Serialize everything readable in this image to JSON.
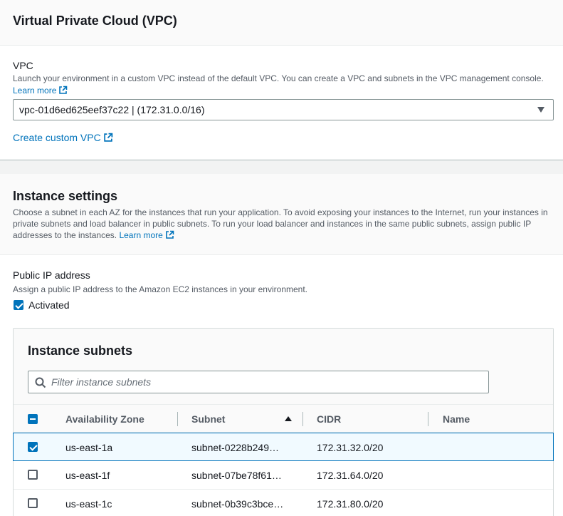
{
  "vpc_section": {
    "title": "Virtual Private Cloud (VPC)",
    "vpc_label": "VPC",
    "vpc_description": "Launch your environment in a custom VPC instead of the default VPC. You can create a VPC and subnets in the VPC management console.",
    "learn_more": "Learn more",
    "vpc_select_value": "vpc-01d6ed625eef37c22 | (172.31.0.0/16)",
    "create_custom_vpc": "Create custom VPC"
  },
  "instance_settings": {
    "title": "Instance settings",
    "description": "Choose a subnet in each AZ for the instances that run your application. To avoid exposing your instances to the Internet, run your instances in private subnets and load balancer in public subnets. To run your load balancer and instances in the same public subnets, assign public IP addresses to the instances.",
    "learn_more": "Learn more",
    "public_ip_label": "Public IP address",
    "public_ip_description": "Assign a public IP address to the Amazon EC2 instances in your environment.",
    "activated_label": "Activated",
    "activated_checked": true
  },
  "subnets_panel": {
    "title": "Instance subnets",
    "search_placeholder": "Filter instance subnets",
    "columns": {
      "az": "Availability Zone",
      "subnet": "Subnet",
      "cidr": "CIDR",
      "name": "Name"
    },
    "sort_column": "Subnet",
    "sort_direction": "ascending",
    "rows": [
      {
        "az": "us-east-1a",
        "subnet": "subnet-0228b249…",
        "cidr": "172.31.32.0/20",
        "name": "",
        "selected": true
      },
      {
        "az": "us-east-1f",
        "subnet": "subnet-07be78f61…",
        "cidr": "172.31.64.0/20",
        "name": "",
        "selected": false
      },
      {
        "az": "us-east-1c",
        "subnet": "subnet-0b39c3bce…",
        "cidr": "172.31.80.0/20",
        "name": "",
        "selected": false
      }
    ]
  },
  "colors": {
    "link": "#0073bb",
    "selected_row_bg": "#f1faff",
    "selected_row_border": "#0073bb"
  }
}
